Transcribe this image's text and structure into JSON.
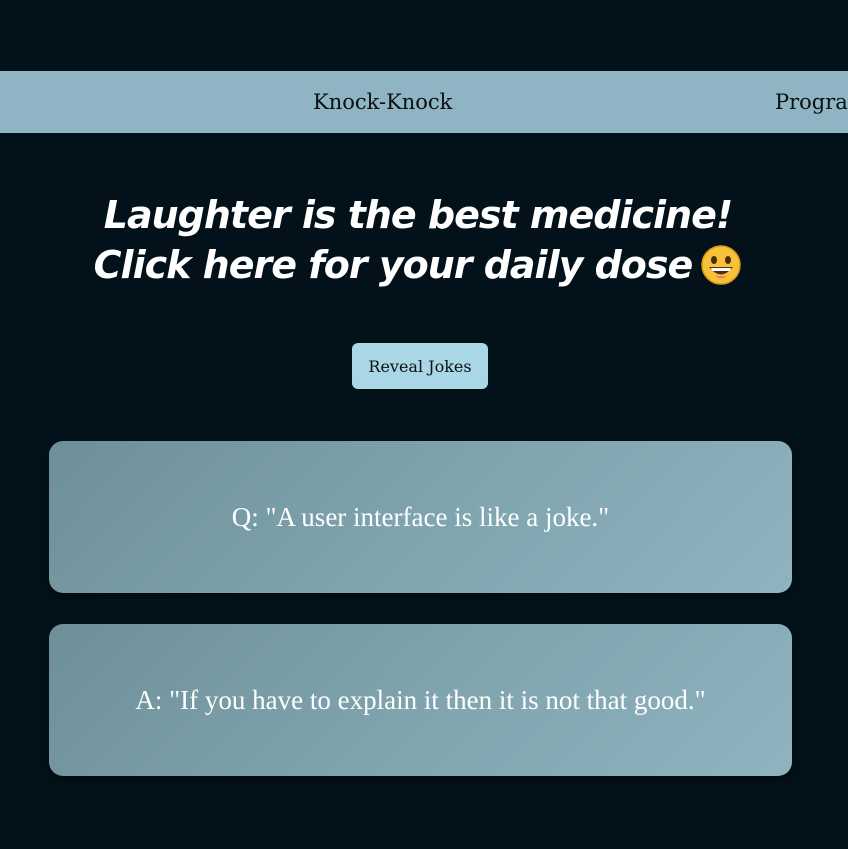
{
  "nav": {
    "links": [
      {
        "label": "Knock-Knock"
      },
      {
        "label": "Progra"
      }
    ]
  },
  "hero": {
    "line1": "Laughter is the best medicine!",
    "line2": "Click here for your daily dose",
    "emoji_icon": "grinning-face-emoji"
  },
  "reveal_button": {
    "label": "Reveal Jokes"
  },
  "jokes": {
    "question": "Q: \"A user interface is like a joke.\"",
    "answer": "A: \"If you have to explain it then it is not that good.\""
  },
  "colors": {
    "background": "#03121a",
    "navbar": "#8fb4c3",
    "button": "#a9d7e5",
    "card": "#7fa4ae"
  }
}
